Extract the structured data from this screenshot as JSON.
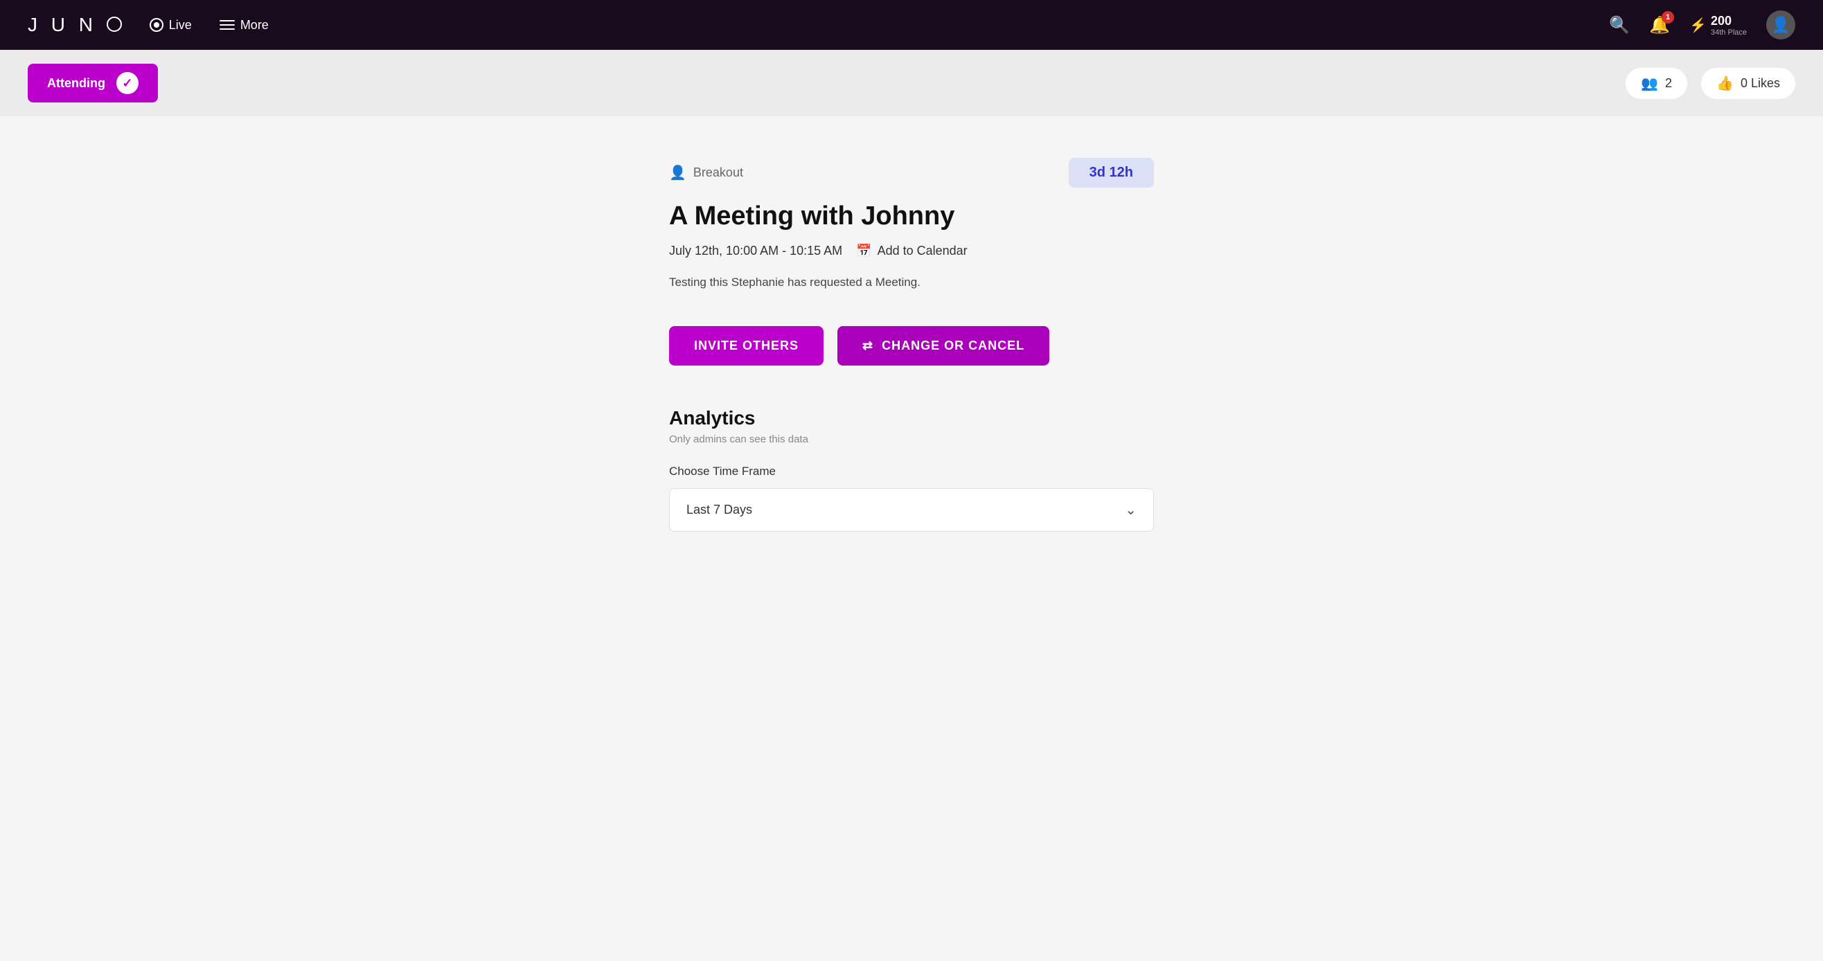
{
  "navbar": {
    "logo": "JUNO",
    "live_label": "Live",
    "more_label": "More",
    "notification_count": "1",
    "points": "200",
    "points_rank": "34th Place"
  },
  "attending_bar": {
    "attending_label": "Attending",
    "attendees_count": "2",
    "likes_count": "0 Likes"
  },
  "event": {
    "breakout_label": "Breakout",
    "time_remaining": "3d 12h",
    "title": "A Meeting with Johnny",
    "date": "July 12th, 10:00 AM - 10:15 AM",
    "add_calendar": "Add to Calendar",
    "description": "Testing this Stephanie has requested a Meeting."
  },
  "buttons": {
    "invite_others": "INVITE OTHERS",
    "change_or_cancel": "CHANGE OR CANCEL"
  },
  "analytics": {
    "title": "Analytics",
    "subtitle": "Only admins can see this data",
    "timeframe_label": "Choose Time Frame",
    "selected_timeframe": "Last 7 Days"
  }
}
